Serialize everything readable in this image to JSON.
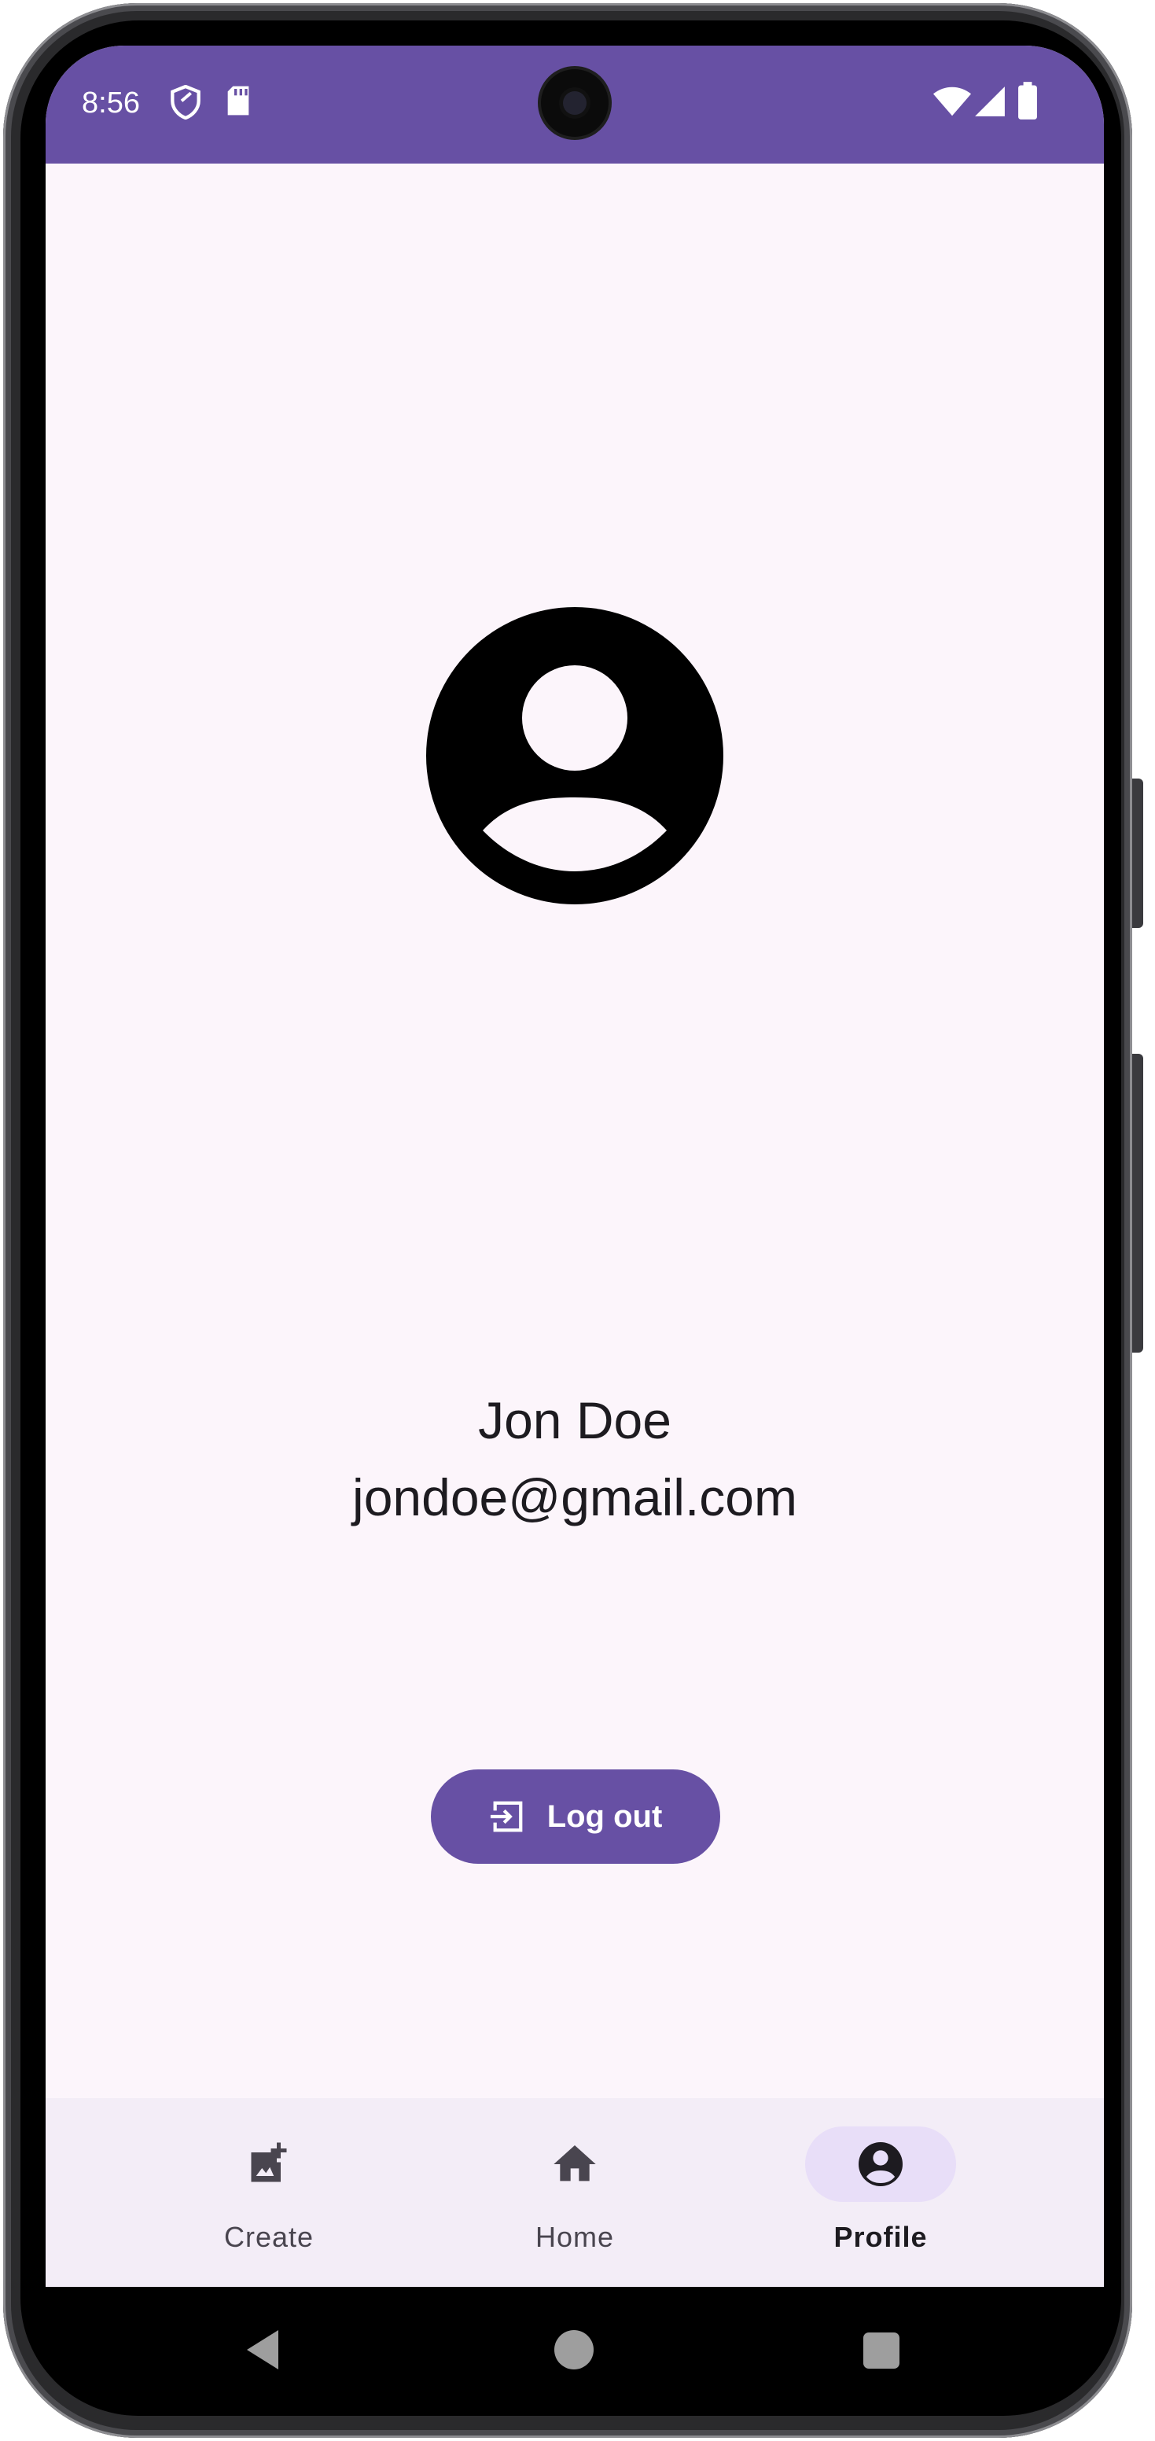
{
  "status_bar": {
    "time": "8:56",
    "left_icons": [
      "shield-icon",
      "sd-card-icon"
    ],
    "right_icons": [
      "wifi-icon",
      "cellular-signal-icon",
      "battery-icon"
    ],
    "background_color": "#6750a4"
  },
  "profile": {
    "avatar_icon": "account-circle-icon",
    "name": "Jon Doe",
    "email": "jondoe@gmail.com"
  },
  "logout_button": {
    "label": "Log out",
    "icon": "logout-icon",
    "color": "#6750a4"
  },
  "bottom_nav": {
    "items": [
      {
        "label": "Create",
        "icon": "add-photo-icon",
        "active": false
      },
      {
        "label": "Home",
        "icon": "home-icon",
        "active": false
      },
      {
        "label": "Profile",
        "icon": "account-circle-icon",
        "active": true
      }
    ],
    "active_indicator_color": "#e8def8"
  },
  "system_nav": {
    "buttons": [
      "back-icon",
      "home-circle-icon",
      "recents-icon"
    ]
  },
  "colors": {
    "screen_background": "#fcf5fb",
    "text_primary": "#1d1b20",
    "nav_background": "#f3edf7"
  }
}
